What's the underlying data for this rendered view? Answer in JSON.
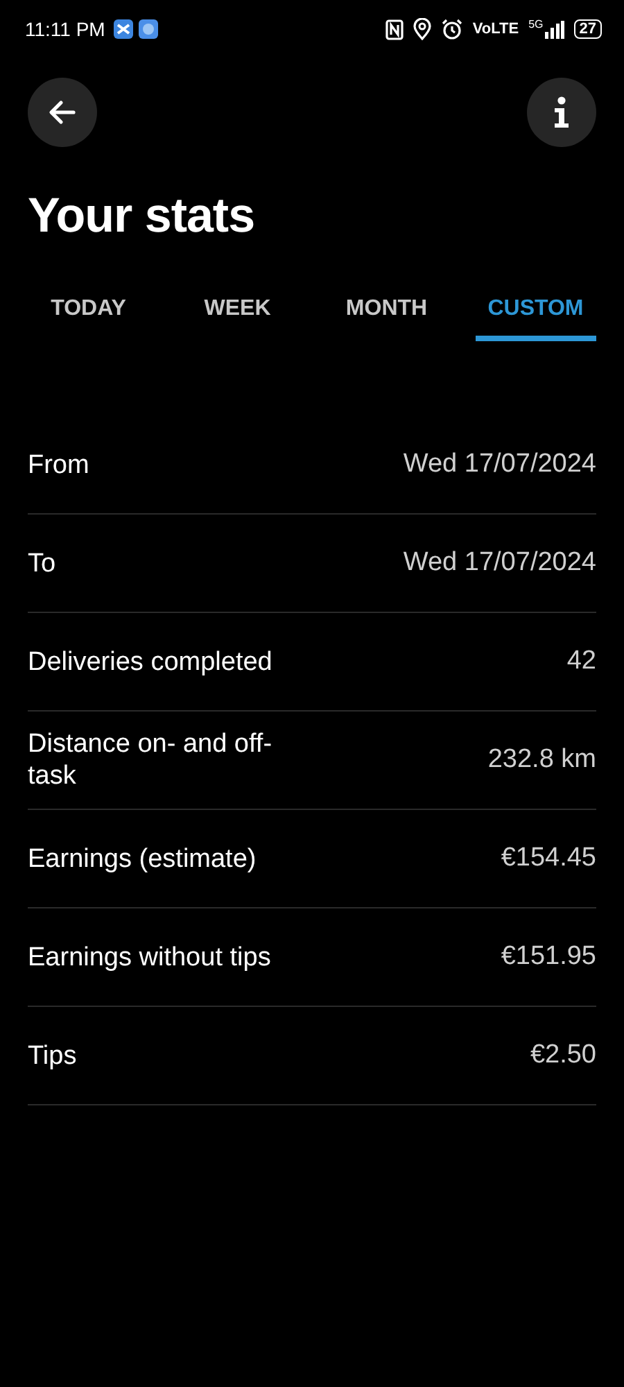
{
  "status_bar": {
    "time": "11:11 PM",
    "network": "VoLTE",
    "cellular": "5G",
    "battery": "27"
  },
  "title": "Your stats",
  "tabs": [
    {
      "label": "TODAY",
      "selected": false
    },
    {
      "label": "WEEK",
      "selected": false
    },
    {
      "label": "MONTH",
      "selected": false
    },
    {
      "label": "CUSTOM",
      "selected": true
    }
  ],
  "stats": [
    {
      "label": "From",
      "value": "Wed 17/07/2024"
    },
    {
      "label": "To",
      "value": "Wed 17/07/2024"
    },
    {
      "label": "Deliveries completed",
      "value": "42"
    },
    {
      "label": "Distance on- and off-task",
      "value": "232.8 km"
    },
    {
      "label": "Earnings (estimate)",
      "value": "€154.45"
    },
    {
      "label": "Earnings without tips",
      "value": "€151.95"
    },
    {
      "label": "Tips",
      "value": "€2.50"
    }
  ]
}
